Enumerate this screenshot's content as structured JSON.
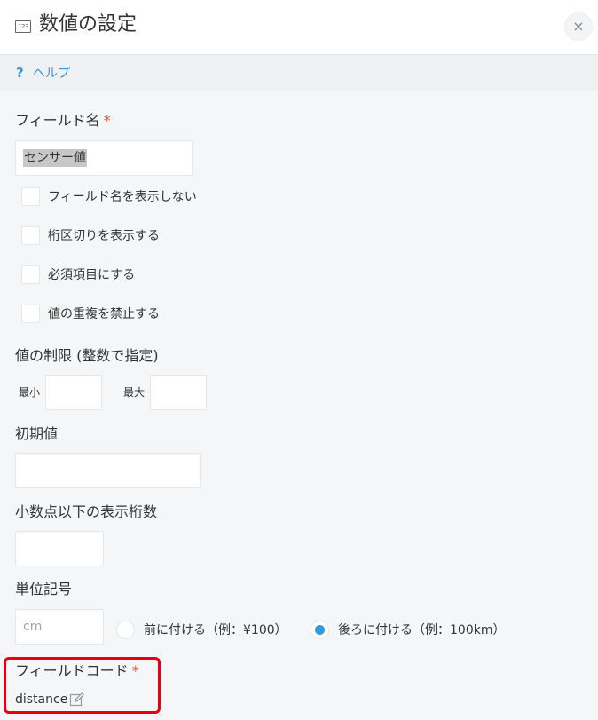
{
  "header": {
    "icon_text": "123",
    "title": "数値の設定",
    "close_label": "×"
  },
  "help": {
    "icon": "?",
    "label": "ヘルプ"
  },
  "field_name": {
    "label": "フィールド名",
    "required": "*",
    "value": "センサー値"
  },
  "options": [
    {
      "label": "フィールド名を表示しない",
      "checked": false
    },
    {
      "label": "桁区切りを表示する",
      "checked": false
    },
    {
      "label": "必須項目にする",
      "checked": false
    },
    {
      "label": "値の重複を禁止する",
      "checked": false
    }
  ],
  "limits": {
    "label": "値の制限 (整数で指定)",
    "min_label": "最小",
    "max_label": "最大",
    "min_value": "",
    "max_value": ""
  },
  "default_value": {
    "label": "初期値",
    "value": ""
  },
  "decimals": {
    "label": "小数点以下の表示桁数",
    "value": ""
  },
  "unit": {
    "label": "単位記号",
    "placeholder": "cm",
    "value": "",
    "before_label": "前に付ける（例：¥100）",
    "after_label": "後ろに付ける（例：100km）",
    "selected": "after"
  },
  "field_code": {
    "label": "フィールドコード",
    "required": "*",
    "value": "distance"
  },
  "colors": {
    "accent": "#3498db",
    "required": "#e74c3c",
    "highlight": "#e60012"
  }
}
